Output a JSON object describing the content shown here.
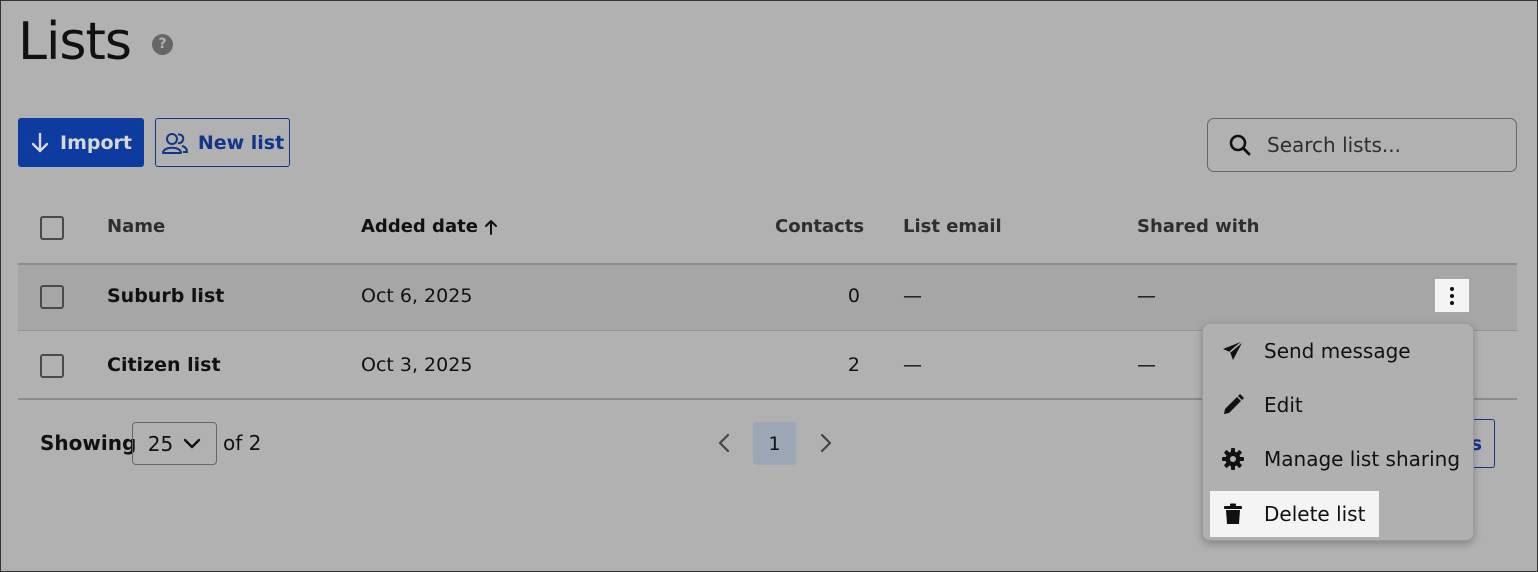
{
  "page": {
    "title": "Lists",
    "help_icon": "?"
  },
  "toolbar": {
    "import_label": "Import",
    "new_list_label": "New list"
  },
  "search": {
    "placeholder": "Search lists..."
  },
  "table": {
    "columns": {
      "name": "Name",
      "added_date": "Added date",
      "contacts": "Contacts",
      "list_email": "List email",
      "shared_with": "Shared with"
    },
    "rows": [
      {
        "name": "Suburb list",
        "added_date": "Oct 6, 2025",
        "contacts": "0",
        "list_email": "—",
        "shared_with": "—"
      },
      {
        "name": "Citizen list",
        "added_date": "Oct 3, 2025",
        "contacts": "2",
        "list_email": "—",
        "shared_with": "—"
      }
    ]
  },
  "footer": {
    "showing_label": "Showing",
    "page_size": "25",
    "of_total": "of 2",
    "current_page": "1",
    "partial_button_text": "s"
  },
  "menu": {
    "items": [
      {
        "label": "Send message",
        "icon": "paper-plane-icon"
      },
      {
        "label": "Edit",
        "icon": "pencil-icon"
      },
      {
        "label": "Manage list sharing",
        "icon": "gear-icon"
      },
      {
        "label": "Delete list",
        "icon": "trash-icon"
      }
    ]
  },
  "colors": {
    "primary": "#0d3ba0",
    "background": "#b1b1b1",
    "highlight": "#f4f4f4"
  }
}
